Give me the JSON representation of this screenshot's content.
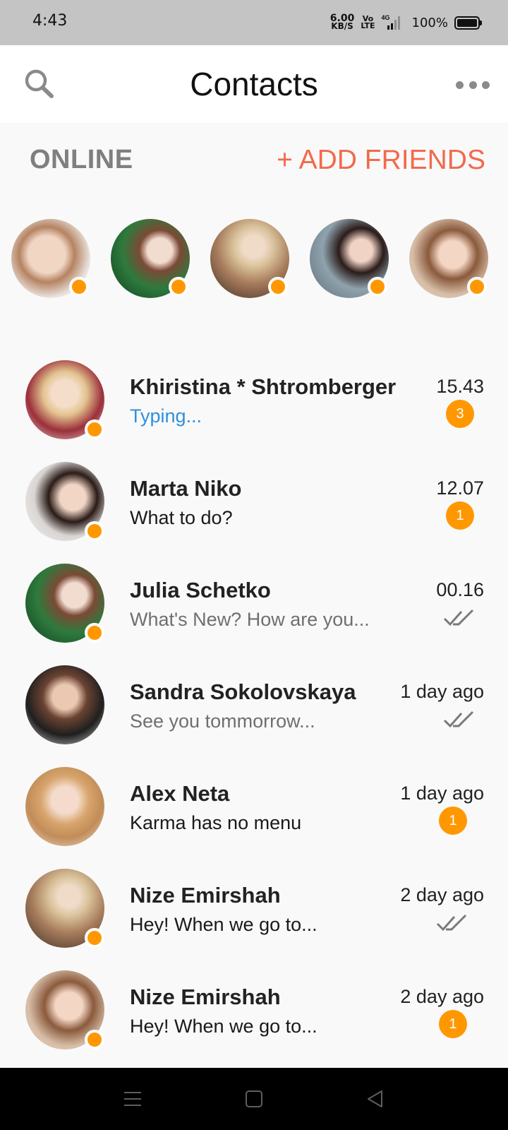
{
  "status_bar": {
    "time": "4:43",
    "net_speed_value": "6.00",
    "net_speed_unit": "KB/S",
    "volte_top": "Vo",
    "volte_bottom": "LTE",
    "network_type": "4G",
    "battery_percent": "100%"
  },
  "header": {
    "title": "Contacts",
    "search_icon": "search-icon",
    "more_icon": "more-horizontal-icon"
  },
  "online": {
    "label": "ONLINE",
    "add_friends_label": "+ ADD FRIENDS",
    "accent_color": "#f26a4b",
    "status_color": "#ff9800",
    "avatars": [
      {
        "icon": "contact-photo-1"
      },
      {
        "icon": "contact-photo-2"
      },
      {
        "icon": "contact-photo-3"
      },
      {
        "icon": "contact-photo-4"
      },
      {
        "icon": "contact-photo-5"
      }
    ]
  },
  "chats": [
    {
      "name": "Khiristina * Shtromberger",
      "message": "Typing...",
      "time": "15.43",
      "unread": "3",
      "online": true,
      "msg_style": "typing"
    },
    {
      "name": "Marta Niko",
      "message": "What to do?",
      "time": "12.07",
      "unread": "1",
      "online": true,
      "msg_style": "normal"
    },
    {
      "name": "Julia Schetko",
      "message": "What's New? How are you...",
      "time": "00.16",
      "read": true,
      "online": true,
      "msg_style": "muted"
    },
    {
      "name": "Sandra Sokolovskaya",
      "message": "See you tommorrow...",
      "time": "1 day ago",
      "read": true,
      "online": false,
      "msg_style": "muted"
    },
    {
      "name": "Alex Neta",
      "message": "Karma has no menu",
      "time": "1 day ago",
      "unread": "1",
      "online": false,
      "msg_style": "normal"
    },
    {
      "name": "Nize Emirshah",
      "message": "Hey! When we go to...",
      "time": "2 day ago",
      "read": true,
      "online": true,
      "msg_style": "normal"
    },
    {
      "name": "Nize Emirshah",
      "message": "Hey! When we go to...",
      "time": "2 day ago",
      "unread": "1",
      "online": true,
      "msg_style": "normal"
    }
  ],
  "nav_bar": {
    "menu_icon": "menu-icon",
    "home_icon": "home-square-icon",
    "back_icon": "back-triangle-icon"
  }
}
